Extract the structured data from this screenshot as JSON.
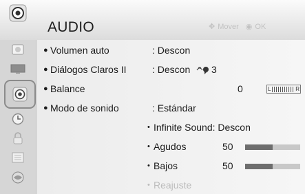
{
  "header": {
    "title": "AUDIO",
    "hint_move": "Mover",
    "hint_ok": "OK",
    "icon": "speaker-icon"
  },
  "sidebar": {
    "items": [
      {
        "icon": "picture-icon",
        "active": false
      },
      {
        "icon": "screen-icon",
        "active": false
      },
      {
        "icon": "speaker-icon",
        "active": true
      },
      {
        "icon": "clock-icon",
        "active": false
      },
      {
        "icon": "lock-icon",
        "active": false
      },
      {
        "icon": "options-icon",
        "active": false
      },
      {
        "icon": "network-icon",
        "active": false
      }
    ]
  },
  "menu": {
    "volumen_auto": {
      "bullet": "●",
      "label": "Volumen auto",
      "value": ": Descon"
    },
    "dialogos": {
      "bullet": "●",
      "label": "Diálogos Claros II",
      "value": ": Descon",
      "level": "3"
    },
    "balance": {
      "bullet": "●",
      "label": "Balance",
      "value": "0",
      "left": "L",
      "right": "R"
    },
    "modo_sonido": {
      "bullet": "●",
      "label": "Modo de sonido",
      "value": ": Estándar"
    },
    "infinite": {
      "bullet": "•",
      "label": "Infinite Sound: Descon"
    },
    "agudos": {
      "bullet": "•",
      "label": "Agudos",
      "value": "50",
      "level_fraction": 0.5
    },
    "bajos": {
      "bullet": "•",
      "label": "Bajos",
      "value": "50",
      "level_fraction": 0.5
    },
    "reajuste": {
      "bullet": "•",
      "label": "Reajuste"
    }
  },
  "colors": {
    "bar_fill": "#6d6d6d",
    "bar_track": "#c8c8c8",
    "hint": "#c2c2c2"
  }
}
